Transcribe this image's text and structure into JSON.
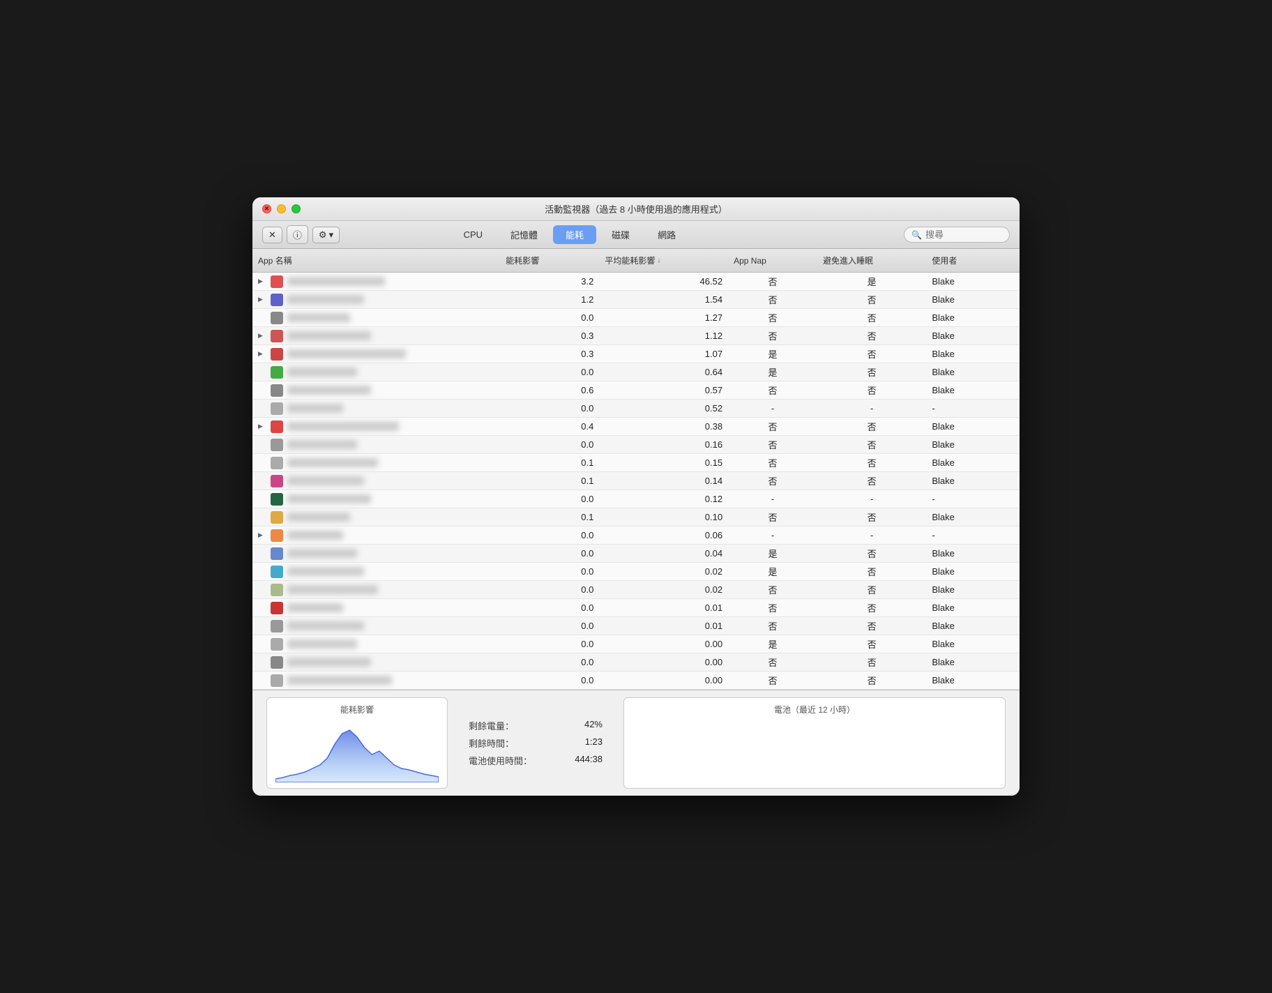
{
  "window": {
    "title": "活動監視器（過去 8 小時使用過的應用程式）"
  },
  "tabs": [
    {
      "id": "cpu",
      "label": "CPU",
      "active": false
    },
    {
      "id": "memory",
      "label": "記憶體",
      "active": false
    },
    {
      "id": "energy",
      "label": "能耗",
      "active": true
    },
    {
      "id": "disk",
      "label": "磁碟",
      "active": false
    },
    {
      "id": "network",
      "label": "網路",
      "active": false
    }
  ],
  "search": {
    "placeholder": "搜尋"
  },
  "toolbar": {
    "close_label": "✕",
    "info_label": "ⓘ",
    "settings_label": "⚙ ▾"
  },
  "table": {
    "columns": [
      {
        "id": "app",
        "label": "App 名稱",
        "sortable": false
      },
      {
        "id": "energy_impact",
        "label": "能耗影響",
        "sortable": false
      },
      {
        "id": "avg_energy",
        "label": "平均能耗影響",
        "sortable": true,
        "sorted": "desc"
      },
      {
        "id": "app_nap",
        "label": "App Nap",
        "sortable": false
      },
      {
        "id": "prevent_sleep",
        "label": "避免進入睡眠",
        "sortable": false
      },
      {
        "id": "user",
        "label": "使用者",
        "sortable": false
      }
    ],
    "rows": [
      {
        "has_arrow": true,
        "icon_color": "#e05050",
        "name_width": 140,
        "energy_impact": "3.2",
        "avg_energy": "46.52",
        "app_nap": "否",
        "prevent_sleep": "是",
        "user": "Blake"
      },
      {
        "has_arrow": true,
        "icon_color": "#6060cc",
        "name_width": 110,
        "energy_impact": "1.2",
        "avg_energy": "1.54",
        "app_nap": "否",
        "prevent_sleep": "否",
        "user": "Blake"
      },
      {
        "has_arrow": false,
        "icon_color": "#888888",
        "name_width": 90,
        "energy_impact": "0.0",
        "avg_energy": "1.27",
        "app_nap": "否",
        "prevent_sleep": "否",
        "user": "Blake"
      },
      {
        "has_arrow": true,
        "icon_color": "#cc5555",
        "name_width": 120,
        "energy_impact": "0.3",
        "avg_energy": "1.12",
        "app_nap": "否",
        "prevent_sleep": "否",
        "user": "Blake"
      },
      {
        "has_arrow": true,
        "icon_color": "#cc4444",
        "name_width": 170,
        "energy_impact": "0.3",
        "avg_energy": "1.07",
        "app_nap": "是",
        "prevent_sleep": "否",
        "user": "Blake"
      },
      {
        "has_arrow": false,
        "icon_color": "#44aa44",
        "name_width": 100,
        "energy_impact": "0.0",
        "avg_energy": "0.64",
        "app_nap": "是",
        "prevent_sleep": "否",
        "user": "Blake"
      },
      {
        "has_arrow": false,
        "icon_color": "#888888",
        "name_width": 120,
        "energy_impact": "0.6",
        "avg_energy": "0.57",
        "app_nap": "否",
        "prevent_sleep": "否",
        "user": "Blake"
      },
      {
        "has_arrow": false,
        "icon_color": "#aaaaaa",
        "name_width": 80,
        "energy_impact": "0.0",
        "avg_energy": "0.52",
        "app_nap": "-",
        "prevent_sleep": "-",
        "user": "-"
      },
      {
        "has_arrow": true,
        "icon_color": "#dd4444",
        "name_width": 160,
        "energy_impact": "0.4",
        "avg_energy": "0.38",
        "app_nap": "否",
        "prevent_sleep": "否",
        "user": "Blake"
      },
      {
        "has_arrow": false,
        "icon_color": "#999999",
        "name_width": 100,
        "energy_impact": "0.0",
        "avg_energy": "0.16",
        "app_nap": "否",
        "prevent_sleep": "否",
        "user": "Blake"
      },
      {
        "has_arrow": false,
        "icon_color": "#aaaaaa",
        "name_width": 130,
        "energy_impact": "0.1",
        "avg_energy": "0.15",
        "app_nap": "否",
        "prevent_sleep": "否",
        "user": "Blake"
      },
      {
        "has_arrow": false,
        "icon_color": "#cc4488",
        "name_width": 110,
        "energy_impact": "0.1",
        "avg_energy": "0.14",
        "app_nap": "否",
        "prevent_sleep": "否",
        "user": "Blake"
      },
      {
        "has_arrow": false,
        "icon_color": "#226644",
        "name_width": 120,
        "energy_impact": "0.0",
        "avg_energy": "0.12",
        "app_nap": "-",
        "prevent_sleep": "-",
        "user": "-"
      },
      {
        "has_arrow": false,
        "icon_color": "#ddaa44",
        "name_width": 90,
        "energy_impact": "0.1",
        "avg_energy": "0.10",
        "app_nap": "否",
        "prevent_sleep": "否",
        "user": "Blake"
      },
      {
        "has_arrow": true,
        "icon_color": "#ee8844",
        "name_width": 80,
        "energy_impact": "0.0",
        "avg_energy": "0.06",
        "app_nap": "-",
        "prevent_sleep": "-",
        "user": "-"
      },
      {
        "has_arrow": false,
        "icon_color": "#6688cc",
        "name_width": 100,
        "energy_impact": "0.0",
        "avg_energy": "0.04",
        "app_nap": "是",
        "prevent_sleep": "否",
        "user": "Blake"
      },
      {
        "has_arrow": false,
        "icon_color": "#44aacc",
        "name_width": 110,
        "energy_impact": "0.0",
        "avg_energy": "0.02",
        "app_nap": "是",
        "prevent_sleep": "否",
        "user": "Blake"
      },
      {
        "has_arrow": false,
        "icon_color": "#aabb88",
        "name_width": 130,
        "energy_impact": "0.0",
        "avg_energy": "0.02",
        "app_nap": "否",
        "prevent_sleep": "否",
        "user": "Blake"
      },
      {
        "has_arrow": false,
        "icon_color": "#cc3333",
        "name_width": 80,
        "energy_impact": "0.0",
        "avg_energy": "0.01",
        "app_nap": "否",
        "prevent_sleep": "否",
        "user": "Blake"
      },
      {
        "has_arrow": false,
        "icon_color": "#999999",
        "name_width": 110,
        "energy_impact": "0.0",
        "avg_energy": "0.01",
        "app_nap": "否",
        "prevent_sleep": "否",
        "user": "Blake"
      },
      {
        "has_arrow": false,
        "icon_color": "#aaaaaa",
        "name_width": 100,
        "energy_impact": "0.0",
        "avg_energy": "0.00",
        "app_nap": "是",
        "prevent_sleep": "否",
        "user": "Blake"
      },
      {
        "has_arrow": false,
        "icon_color": "#888888",
        "name_width": 120,
        "energy_impact": "0.0",
        "avg_energy": "0.00",
        "app_nap": "否",
        "prevent_sleep": "否",
        "user": "Blake"
      },
      {
        "has_arrow": false,
        "icon_color": "#aaaaaa",
        "name_width": 150,
        "energy_impact": "0.0",
        "avg_energy": "0.00",
        "app_nap": "否",
        "prevent_sleep": "否",
        "user": "Blake"
      }
    ]
  },
  "bottom_panel": {
    "energy_section": {
      "title": "能耗影響"
    },
    "stats": {
      "remaining_charge_label": "剩餘電量：",
      "remaining_charge_value": "42%",
      "remaining_time_label": "剩餘時間：",
      "remaining_time_value": "1:23",
      "battery_time_label": "電池使用時間：",
      "battery_time_value": "444:38"
    },
    "battery_section": {
      "title": "電池（最近 12 小時）"
    }
  }
}
